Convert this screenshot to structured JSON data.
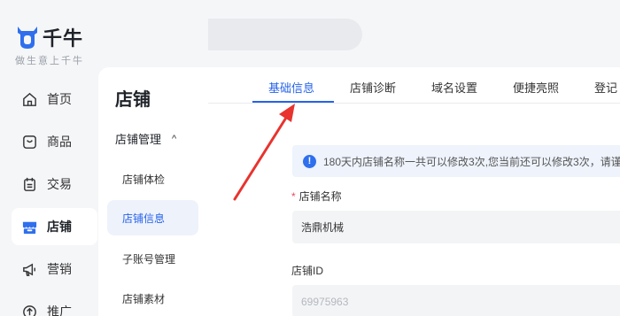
{
  "brand": {
    "name": "千牛",
    "slogan": "做生意上千牛",
    "color": "#2f6fed"
  },
  "nav": {
    "items": [
      {
        "label": "首页",
        "icon": "home-icon"
      },
      {
        "label": "商品",
        "icon": "product-icon"
      },
      {
        "label": "交易",
        "icon": "trade-icon"
      },
      {
        "label": "店铺",
        "icon": "store-icon",
        "active": true
      },
      {
        "label": "营销",
        "icon": "megaphone-icon"
      },
      {
        "label": "推广",
        "icon": "promote-icon"
      }
    ]
  },
  "topbar": {
    "history_icon": "clock-icon",
    "search_icon": "search-icon",
    "search_placeholder": ""
  },
  "subnav": {
    "title": "店铺",
    "group_label": "店铺管理",
    "group_caret": "^",
    "items": [
      {
        "label": "店铺体检"
      },
      {
        "label": "店铺信息",
        "active": true
      },
      {
        "label": "子账号管理"
      },
      {
        "label": "店铺素材"
      }
    ]
  },
  "tabs": [
    {
      "label": "基础信息",
      "active": true
    },
    {
      "label": "店铺诊断"
    },
    {
      "label": "域名设置"
    },
    {
      "label": "便捷亮照"
    },
    {
      "label": "登记"
    }
  ],
  "notice": {
    "icon": "info-icon",
    "icon_glyph": "!",
    "text": "180天内店铺名称一共可以修改3次,您当前还可以修改3次，请谨"
  },
  "form": {
    "store_name": {
      "required_mark": "*",
      "label": "店铺名称",
      "value": "浩鼎机械"
    },
    "store_id": {
      "label": "店铺ID",
      "value": "69975963"
    }
  },
  "colors": {
    "accent": "#2563eb",
    "annotation_arrow": "#e8332e",
    "sidebar_bg": "#f5f6f8",
    "required": "#e34d59"
  }
}
